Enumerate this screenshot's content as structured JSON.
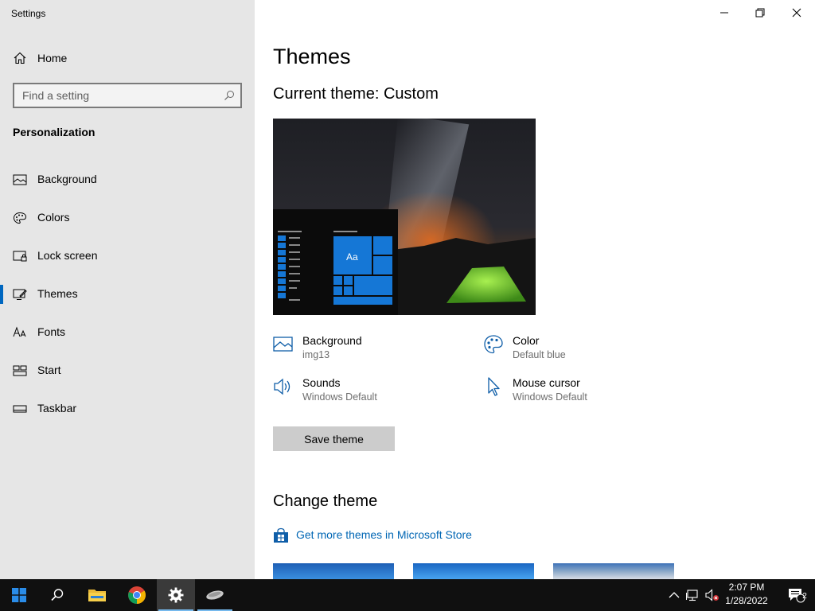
{
  "window": {
    "title": "Settings",
    "controls": [
      "minimize-icon",
      "restore-icon",
      "close-icon"
    ]
  },
  "sidebar": {
    "home_label": "Home",
    "search_placeholder": "Find a setting",
    "section_title": "Personalization",
    "items": [
      {
        "label": "Background",
        "icon": "picture-icon",
        "active": false
      },
      {
        "label": "Colors",
        "icon": "palette-icon",
        "active": false
      },
      {
        "label": "Lock screen",
        "icon": "lock-screen-icon",
        "active": false
      },
      {
        "label": "Themes",
        "icon": "themes-icon",
        "active": true
      },
      {
        "label": "Fonts",
        "icon": "fonts-icon",
        "active": false
      },
      {
        "label": "Start",
        "icon": "start-icon",
        "active": false
      },
      {
        "label": "Taskbar",
        "icon": "taskbar-icon",
        "active": false
      }
    ]
  },
  "main": {
    "title": "Themes",
    "current_theme": "Current theme: Custom",
    "preview_tile_label": "Aa",
    "properties": {
      "background": {
        "name": "Background",
        "value": "img13"
      },
      "color": {
        "name": "Color",
        "value": "Default blue"
      },
      "sounds": {
        "name": "Sounds",
        "value": "Windows Default"
      },
      "mouse_cursor": {
        "name": "Mouse cursor",
        "value": "Windows Default"
      }
    },
    "save_button": "Save theme",
    "change_theme_title": "Change theme",
    "store_link": "Get more themes in Microsoft Store"
  },
  "taskbar": {
    "time": "2:07 PM",
    "date": "1/28/2022",
    "notification_count": "2",
    "apps": [
      "start-icon",
      "search-icon",
      "file-explorer-icon",
      "chrome-icon",
      "settings-icon",
      "mouse-app-icon"
    ]
  },
  "colors": {
    "accent": "#0078d7",
    "sidebar_bg": "#e6e6e6",
    "link": "#0066b4",
    "taskbar_bg": "#101010"
  }
}
